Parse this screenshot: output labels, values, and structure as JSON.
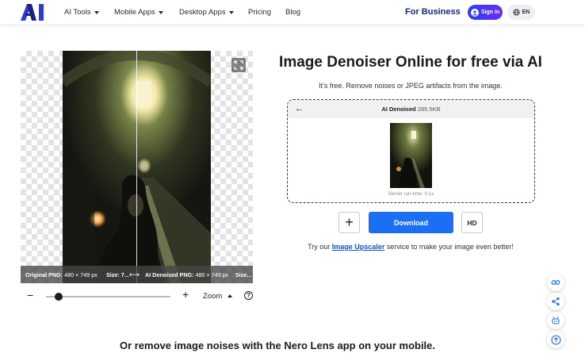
{
  "header": {
    "nav": [
      {
        "label": "AI Tools",
        "has_caret": true
      },
      {
        "label": "Mobile Apps",
        "has_caret": true
      },
      {
        "label": "Desktop Apps",
        "has_caret": true
      },
      {
        "label": "Pricing",
        "has_caret": false
      },
      {
        "label": "Blog",
        "has_caret": false
      }
    ],
    "for_business": "For Business",
    "sign_in": "Sign in",
    "language": "EN"
  },
  "viewer": {
    "original_label": "Original PNG:",
    "original_dims": "480 × 749 px",
    "size_label": "Size: 7...",
    "denoised_label": "AI Denoised PNG:",
    "denoised_dims": "480 × 749 px",
    "size_label_2": "Size..."
  },
  "zoom": {
    "label": "Zoom",
    "level": 0.1,
    "help": "?"
  },
  "main": {
    "title": "Image Denoiser Online for free via AI",
    "subtitle": "It's free. Remove noises or JPEG artifacts from the image.",
    "result": {
      "title": "AI Denoised",
      "size": "285.5KB",
      "runtime": "Server run-time: 0.1s"
    },
    "download": "Download",
    "hd": "HD",
    "upscale_prefix": "Try our",
    "upscale_link": "Image Upscaler",
    "upscale_suffix": "service to make your image even better!"
  },
  "bottom_heading": "Or remove image noises with the Nero Lens app on your mobile.",
  "colors": {
    "accent": "#1a6ff5",
    "brand_navy": "#1a237e",
    "signin_gradient_start": "#2d3df5",
    "signin_gradient_end": "#6b2cf5"
  },
  "icons": [
    "logo-icon",
    "user-icon",
    "globe-icon",
    "expand-icon",
    "back-arrow-icon",
    "plus-icon",
    "minus-icon",
    "help-icon",
    "link-icon",
    "share-icon",
    "robot-icon",
    "arrow-up-icon"
  ]
}
